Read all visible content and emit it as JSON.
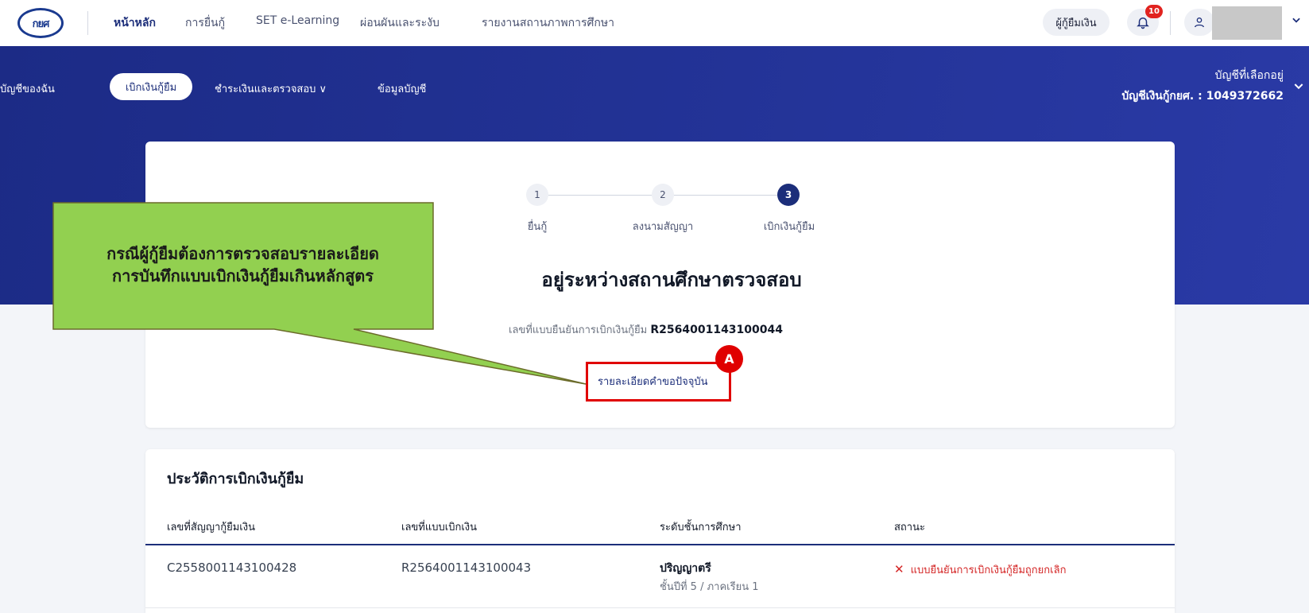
{
  "topnav": {
    "logo_text": "กยศ",
    "links": [
      "หน้าหลัก",
      "การยื่นกู้",
      "SET e-Learning",
      "ผ่อนผันและระงับ",
      "รายงานสถานภาพการศึกษา"
    ],
    "borrower_label": "ผู้กู้ยืมเงิน",
    "notification_count": "10"
  },
  "subnav": {
    "my_account": "บัญชีของฉัน",
    "withdraw": "เบิกเงินกู้ยืม",
    "repay": "ชำระเงินและตรวจสอบ ∨",
    "account_info": "ข้อมูลบัญชี",
    "selected_account_label": "บัญชีที่เลือกอยู่",
    "selected_account_value": "บัญชีเงินกู้กยศ. : 1049372662"
  },
  "steps": [
    {
      "number": "1",
      "label": "ยื่นกู้"
    },
    {
      "number": "2",
      "label": "ลงนามสัญญา"
    },
    {
      "number": "3",
      "label": "เบิกเงินกู้ยืม"
    }
  ],
  "status": {
    "title": "อยู่ระหว่างสถานศึกษาตรวจสอบ",
    "ref_label": "เลขที่แบบยืนยันการเบิกเงินกู้ยืม",
    "ref_number": "R2564001143100044",
    "detail_link": "รายละเอียดคำขอปัจจุบัน"
  },
  "annotation": {
    "marker": "A",
    "callout_line1": "กรณีผู้กู้ยืมต้องการตรวจสอบรายละเอียด",
    "callout_line2": "การบันทึกแบบเบิกเงินกู้ยืมเกินหลักสูตร",
    "callout_color": "#92d050"
  },
  "history": {
    "title": "ประวัติการเบิกเงินกู้ยืม",
    "columns": [
      "เลขที่สัญญากู้ยืมเงิน",
      "เลขที่แบบเบิกเงิน",
      "ระดับชั้นการศึกษา",
      "สถานะ"
    ],
    "rows": [
      {
        "contract": "C2558001143100428",
        "form": "R2564001143100043",
        "level": "ปริญญาตรี",
        "level_detail": "ชั้นปีที่ 5 / ภาคเรียน 1",
        "status": "แบบยืนยันการเบิกเงินกู้ยืมถูกยกเลิก"
      }
    ]
  },
  "colors": {
    "brand_blue": "#1c2e7a",
    "alert_red": "#e00000"
  }
}
